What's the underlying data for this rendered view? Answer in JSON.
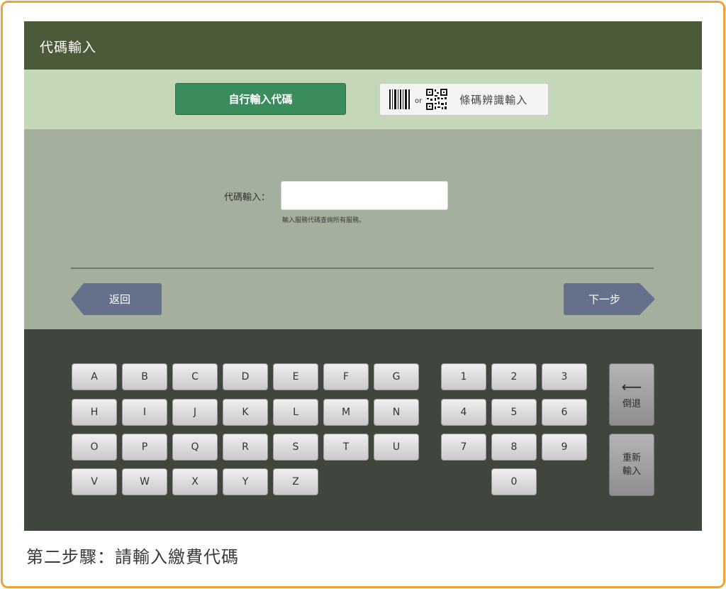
{
  "header": {
    "title": "代碼輸入"
  },
  "tabs": {
    "manual_label": "自行輸入代碼",
    "scan_or": "or",
    "scan_label": "條碼辨識輸入"
  },
  "form": {
    "code_label": "代碼輸入：",
    "code_value": "",
    "hint": "輸入服務代碼查詢所有服務。"
  },
  "nav": {
    "back_label": "返回",
    "next_label": "下一步"
  },
  "keyboard": {
    "letter_rows": [
      [
        "A",
        "B",
        "C",
        "D",
        "E",
        "F",
        "G"
      ],
      [
        "H",
        "I",
        "J",
        "K",
        "L",
        "M",
        "N"
      ],
      [
        "O",
        "P",
        "Q",
        "R",
        "S",
        "T",
        "U"
      ],
      [
        "V",
        "W",
        "X",
        "Y",
        "Z"
      ]
    ],
    "number_rows": [
      [
        "1",
        "2",
        "3"
      ],
      [
        "4",
        "5",
        "6"
      ],
      [
        "7",
        "8",
        "9"
      ],
      [
        "",
        "0",
        ""
      ]
    ],
    "backspace_label": "倒退",
    "backspace_icon": "left-arrow-icon",
    "reset_label": "重新輸入"
  },
  "caption": "第二步驟：請輸入繳費代碼",
  "colors": {
    "frame_border": "#f2a23c",
    "header_bg": "#4c5a3a",
    "tabs_bg": "#c5d7b9",
    "active_tab": "#3a8c5c",
    "form_bg": "#a4b09d",
    "nav_button": "#65718a",
    "keyboard_bg": "#40453d"
  }
}
